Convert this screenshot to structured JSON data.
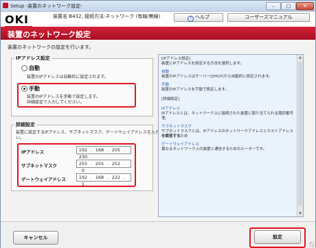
{
  "window": {
    "title": "Setup -装置のネットワーク設定-",
    "minimize": "–",
    "maximize": "□",
    "close": "✕"
  },
  "header": {
    "logo": "OKI",
    "device_info": "装置名:B432, 接続方法:ネットワーク (有線/無線)",
    "help_label": "ヘルプ",
    "manual_label": "ユーザーズマニュアル"
  },
  "page": {
    "title": "装置のネットワーク設定",
    "subtitle": "装置のネットワークの設定を行います。"
  },
  "ip_setting": {
    "group_title": "IPアドレス設定",
    "auto_label": "自動",
    "auto_desc": "装置のIPアドレスは自動的に設定されます。",
    "manual_label": "手動",
    "manual_desc1": "装置のIPアドレスを手動で設定します。",
    "manual_desc2": "詳細設定で入力してください。",
    "selected": "manual"
  },
  "detail": {
    "group_title": "詳細設定",
    "desc1": "装置に設定するIPアドレス、サブネットマスク、ゲートウェイアドレスを入力してくださ",
    "desc2": "い。",
    "fields": [
      {
        "label": "IPアドレス",
        "octets": [
          "192",
          "168",
          "205",
          "230"
        ]
      },
      {
        "label": "サブネットマスク",
        "octets": [
          "255",
          "255",
          "252",
          "0"
        ]
      },
      {
        "label": "ゲートウェイアドレス",
        "octets": [
          "192",
          "168",
          "222",
          "1"
        ]
      }
    ]
  },
  "help_panel": {
    "l1": "[IPアドレス設定]",
    "l2": "装置にIPアドレスを設定する方法を選択します。",
    "l3": "自動",
    "l4": "装置のIPアドレスはサーバー(DHCP)から自動的に設定されます。",
    "l5": "手動",
    "l6": "装置のIPアドレスを手動で設定します。",
    "l7": "[詳細設定]",
    "l8": "IPアドレス",
    "l9": "IPアドレスとは、ネットワーク上に接続された装置に割り当てられる識別番号で",
    "l10": "す。",
    "l11": "サブネットマスク",
    "l12": "サブネットマスクとは、IPアドレスのネットワークアドレスとホストアドレスを識別するため",
    "l13": "の数値です。",
    "l14": "ゲートウェイアドレス",
    "l15": "異なるネットワーク上の装置と通信するためのルーターです。"
  },
  "footer": {
    "cancel_label": "キャンセル",
    "apply_label": "設定"
  },
  "colors": {
    "brand_red": "#c8102e",
    "highlight_red": "#e0141e",
    "help_link": "#2a5fb3"
  }
}
